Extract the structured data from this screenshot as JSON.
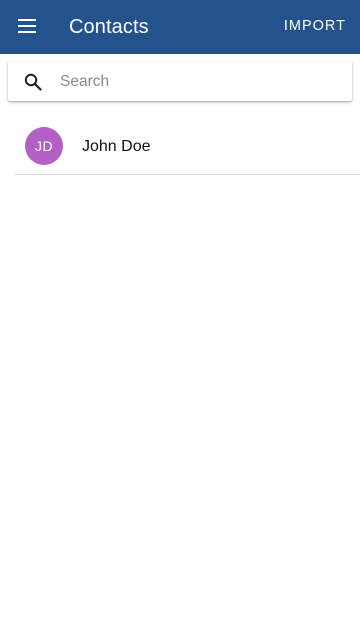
{
  "appbar": {
    "title": "Contacts",
    "menu_icon": "hamburger-menu-icon",
    "import_label": "IMPORT",
    "background": "#24528d"
  },
  "search": {
    "icon": "search-icon",
    "placeholder": "Search",
    "value": ""
  },
  "contacts": [
    {
      "initials": "JD",
      "name": "John Doe",
      "avatar_color": "#b25fc6"
    }
  ]
}
